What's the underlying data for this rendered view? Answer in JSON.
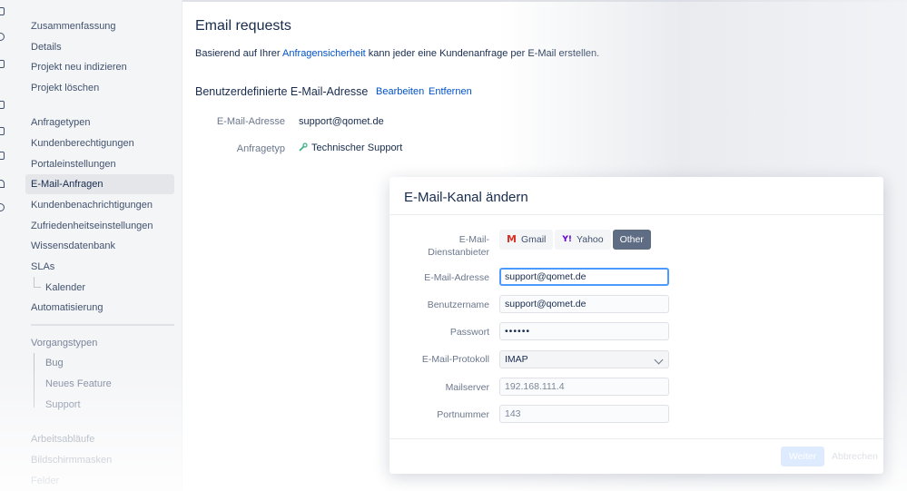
{
  "sidebar": {
    "items": [
      {
        "label": "Zusammenfassung"
      },
      {
        "label": "Details"
      },
      {
        "label": "Projekt neu indizieren"
      },
      {
        "label": "Projekt löschen"
      },
      {
        "label": "Anfragetypen"
      },
      {
        "label": "Kundenberechtigungen"
      },
      {
        "label": "Portaleinstellungen"
      },
      {
        "label": "E-Mail-Anfragen"
      },
      {
        "label": "Kundenbenachrichtigungen"
      },
      {
        "label": "Zufriedenheitseinstellungen"
      },
      {
        "label": "Wissensdatenbank"
      },
      {
        "label": "SLAs"
      },
      {
        "label": "Kalender"
      },
      {
        "label": "Automatisierung"
      },
      {
        "label": "Vorgangstypen"
      },
      {
        "label": "Bug"
      },
      {
        "label": "Neues Feature"
      },
      {
        "label": "Support"
      },
      {
        "label": "Arbeitsabläufe"
      },
      {
        "label": "Bildschirmmasken"
      },
      {
        "label": "Felder"
      }
    ]
  },
  "main": {
    "title": "Email requests",
    "intro_before": "Basierend auf Ihrer ",
    "intro_link": "Anfragensicherheit",
    "intro_after": " kann jeder eine Kundenanfrage per E-Mail erstellen.",
    "section_title": "Benutzerdefinierte E-Mail-Adresse",
    "edit_link": "Bearbeiten",
    "remove_link": "Entfernen",
    "email_label": "E-Mail-Adresse",
    "email_value": "support@qomet.de",
    "type_label": "Anfragetyp",
    "type_value": "Technischer Support"
  },
  "modal": {
    "title": "E-Mail-Kanal ändern",
    "provider_label_1": "E-Mail-",
    "provider_label_2": "Dienstanbieter",
    "providers": [
      {
        "label": "Gmail",
        "icon": "gmail-icon",
        "glyph": "M"
      },
      {
        "label": "Yahoo",
        "icon": "yahoo-icon",
        "glyph": "Y!"
      },
      {
        "label": "Other"
      }
    ],
    "selected_provider": "Other",
    "fields": {
      "email": {
        "label": "E-Mail-Adresse",
        "value": "support@qomet.de"
      },
      "username": {
        "label": "Benutzername",
        "value": "support@qomet.de"
      },
      "password": {
        "label": "Passwort",
        "value": "••••••"
      },
      "protocol": {
        "label": "E-Mail-Protokoll",
        "value": "IMAP"
      },
      "server": {
        "label": "Mailserver",
        "value": "192.168.111.4"
      },
      "port": {
        "label": "Portnummer",
        "value": "143"
      }
    },
    "next_button": "Weiter",
    "cancel_button": "Abbrechen"
  },
  "colors": {
    "accent": "#0052cc",
    "selected_segment": "#5e6c84",
    "focus_border": "#4c9aff"
  }
}
